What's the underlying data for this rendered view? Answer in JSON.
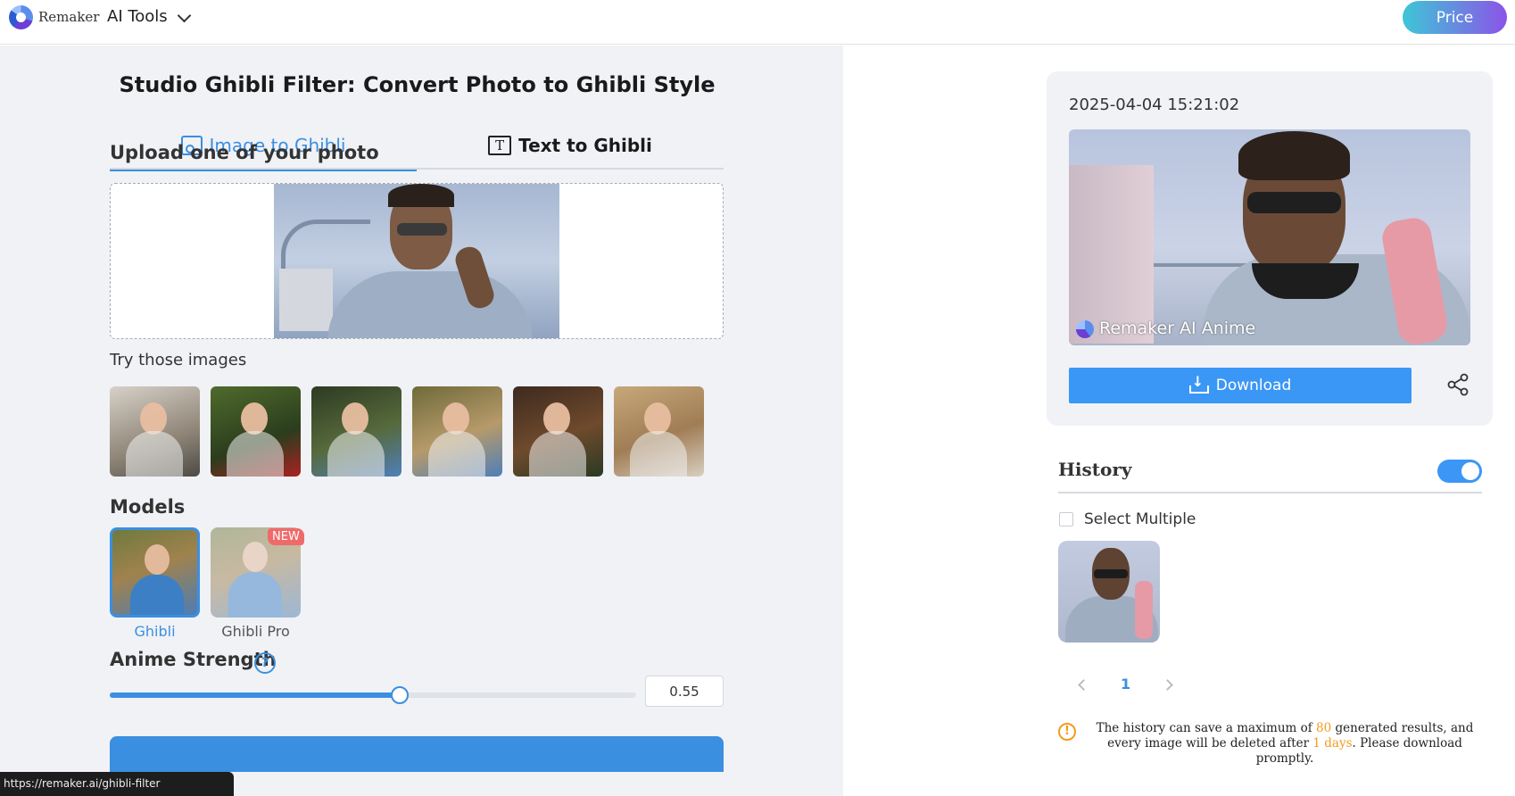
{
  "header": {
    "brand": "Remaker",
    "menu_label": "AI Tools",
    "price_label": "Price"
  },
  "page": {
    "title": "Studio Ghibli Filter: Convert Photo to Ghibli Style"
  },
  "tabs": [
    {
      "label": "Image to Ghibli",
      "icon": "image-stack-icon",
      "active": true
    },
    {
      "label": "Text to Ghibli",
      "icon": "text-box-icon",
      "active": false
    }
  ],
  "upload": {
    "label": "Upload one of your photo"
  },
  "samples": {
    "label": "Try those images"
  },
  "models": {
    "label": "Models",
    "items": [
      {
        "name": "Ghibli",
        "selected": true
      },
      {
        "name": "Ghibli Pro",
        "selected": false,
        "badge": "NEW"
      }
    ]
  },
  "strength": {
    "label": "Anime Strength",
    "help": "?",
    "value": 0.55,
    "value_text": "0.55"
  },
  "status_bar": {
    "url": "https://remaker.ai/ghibli-filter"
  },
  "result": {
    "timestamp": "2025-04-04 15:21:02",
    "watermark": "Remaker AI Anime",
    "download_label": "Download"
  },
  "history": {
    "title": "History",
    "toggle_on": true,
    "select_multiple_label": "Select Multiple",
    "current_page": "1",
    "notice_parts": {
      "p1": "The history can save a maximum of ",
      "max": "80",
      "p2": " generated results, and every image will be deleted after ",
      "days": "1 days",
      "p3": ". Please download promptly."
    }
  },
  "colors": {
    "accent": "#3b8fe0",
    "download": "#3b97f5",
    "warning": "#f39b1e",
    "new_badge": "#f06a6a",
    "panel_bg": "#f0f2f6"
  }
}
